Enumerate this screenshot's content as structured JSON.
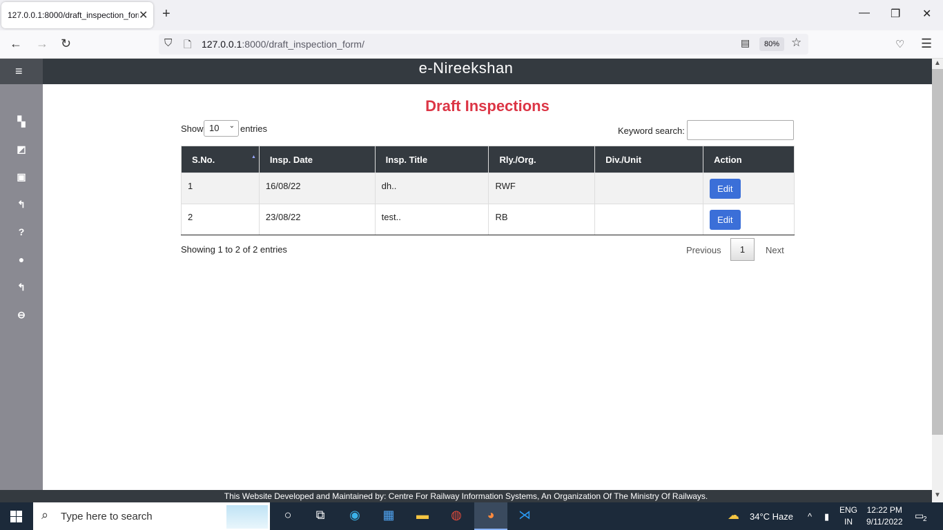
{
  "browser": {
    "tab_title": "127.0.0.1:8000/draft_inspection_form/",
    "url_host": "127.0.0.1",
    "url_rest": ":8000/draft_inspection_form/",
    "zoom": "80%"
  },
  "app": {
    "title": "e-Nireekshan",
    "page_heading": "Draft Inspections"
  },
  "table_controls": {
    "show_label": "Show",
    "entries_value": "10",
    "entries_label": "entries",
    "search_label": "Keyword search:"
  },
  "table": {
    "headers": [
      "S.No.",
      "Insp. Date",
      "Insp. Title",
      "Rly./Org.",
      "Div./Unit",
      "Action"
    ],
    "rows": [
      {
        "sno": "1",
        "date": "16/08/22",
        "title": "dh..",
        "rly": "RWF",
        "div": "",
        "action": "Edit"
      },
      {
        "sno": "2",
        "date": "23/08/22",
        "title": "test..",
        "rly": "RB",
        "div": "",
        "action": "Edit"
      }
    ]
  },
  "pagination": {
    "info": "Showing 1 to 2 of 2 entries",
    "previous": "Previous",
    "current": "1",
    "next": "Next"
  },
  "footer": "This Website Developed and Maintained by: Centre For Railway Information Systems, An Organization Of The Ministry Of Railways.",
  "taskbar": {
    "search_placeholder": "Type here to search",
    "weather": "34°C  Haze",
    "lang_top": "ENG",
    "lang_bottom": "IN",
    "time": "12:22 PM",
    "date": "9/11/2022",
    "notifications": "2"
  },
  "colors": {
    "header_bg": "#343a40",
    "heading_red": "#dc3545",
    "edit_blue": "#3b6fd8",
    "sidebar_bg": "#8a8a92"
  }
}
